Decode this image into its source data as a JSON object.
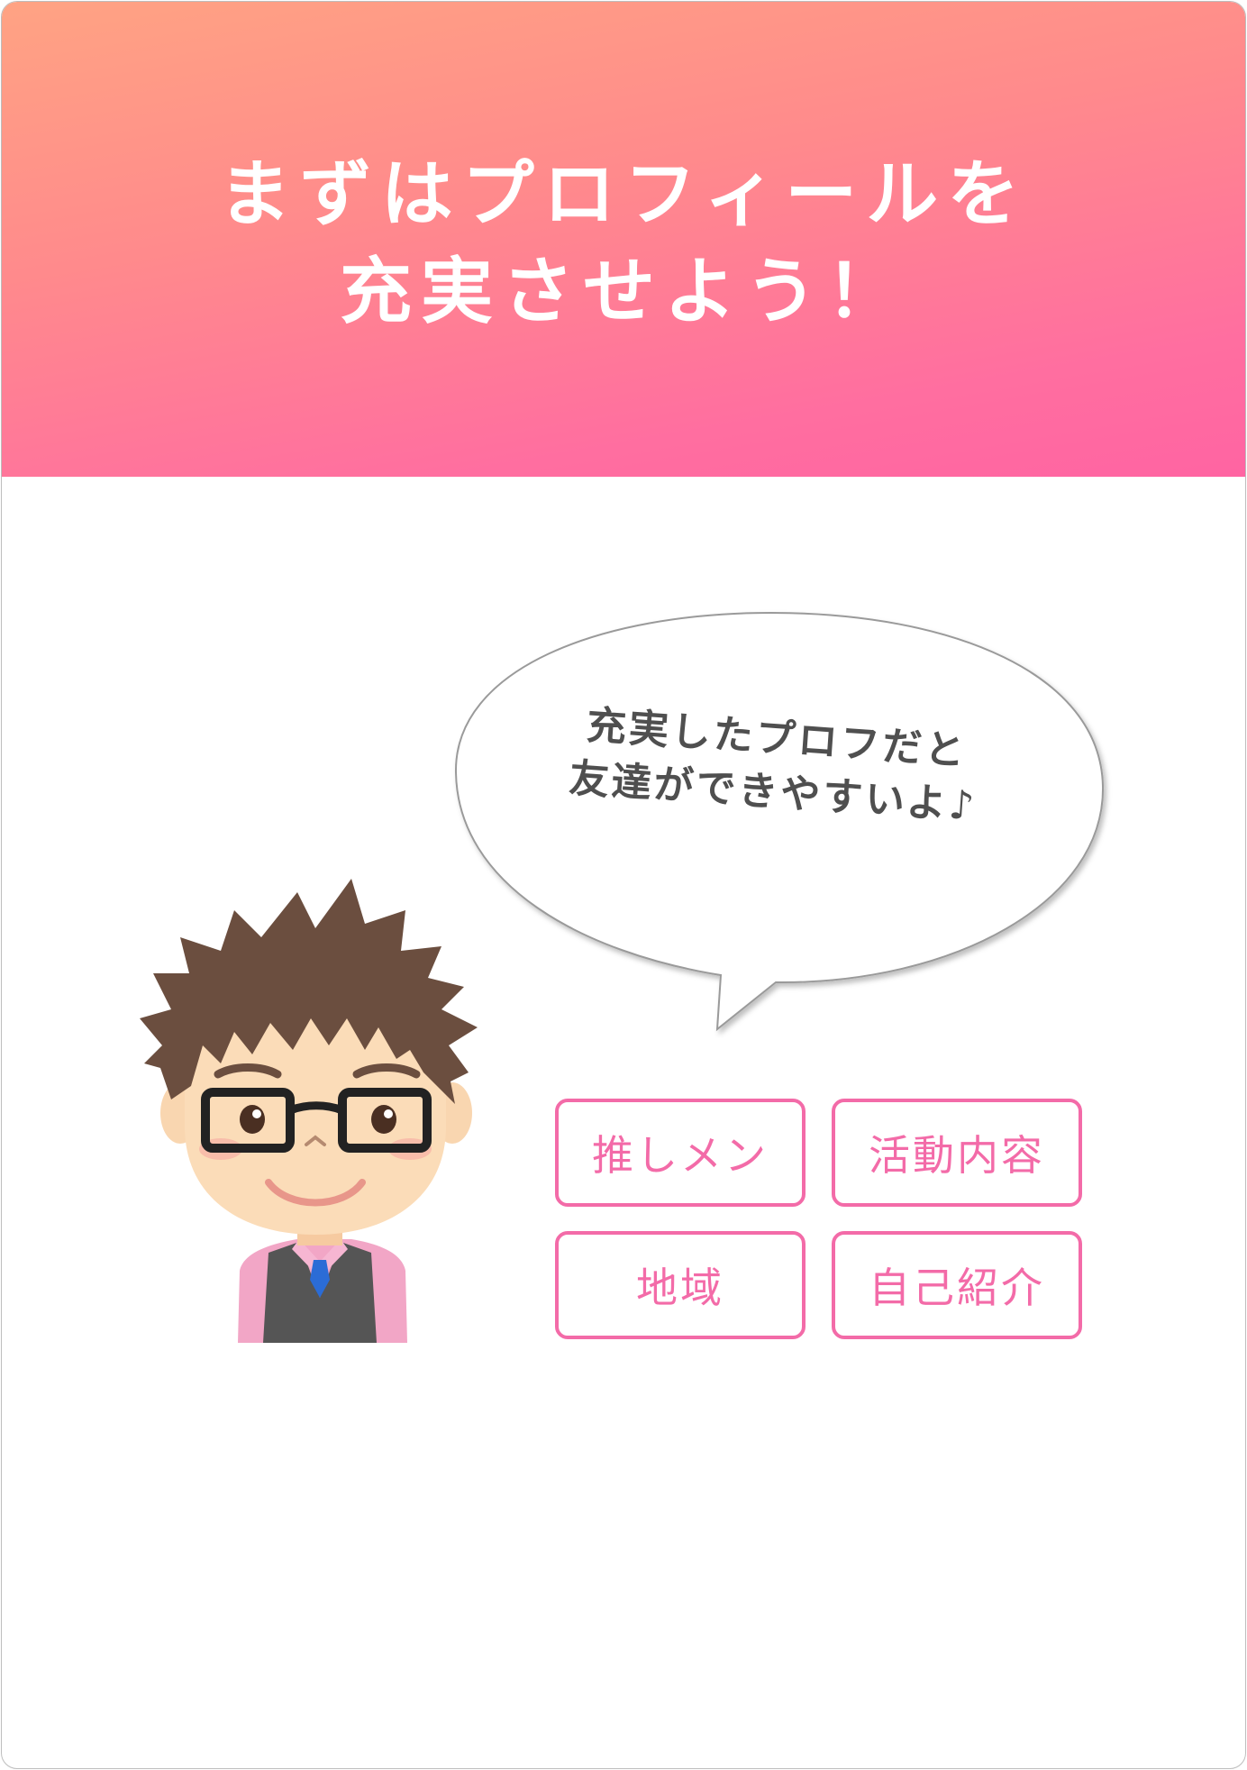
{
  "header": {
    "title_line1": "まずはプロフィールを",
    "title_line2": "充実させよう！"
  },
  "speech_bubble": {
    "line1": "充実したプロフだと",
    "line2": "友達ができやすいよ♪"
  },
  "profile_tags": [
    {
      "label": "推しメン"
    },
    {
      "label": "活動内容"
    },
    {
      "label": "地域"
    },
    {
      "label": "自己紹介"
    }
  ],
  "colors": {
    "header_gradient_start": "#ffa383",
    "header_gradient_end": "#ff64a2",
    "tag_accent": "#f36ba8",
    "bubble_text": "#4f4f4f"
  },
  "icons": [
    "avatar-illustration",
    "speech-bubble"
  ]
}
